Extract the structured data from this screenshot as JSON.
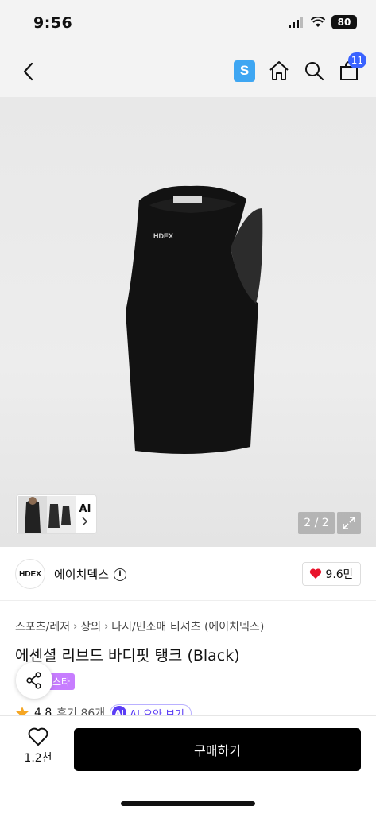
{
  "status_bar": {
    "time": "9:56",
    "battery": "80"
  },
  "nav": {
    "badge_letter": "S",
    "cart_count": "11"
  },
  "gallery": {
    "thumb_label": "AI",
    "counter": "2 / 2",
    "product_logo": "HDEX"
  },
  "brand": {
    "logo_text": "HDEX",
    "name": "에이치덱스",
    "likes": "9.6만"
  },
  "breadcrumb": [
    "스포츠/레저",
    "상의",
    "나시/민소매 티셔츠 (에이치덱스)"
  ],
  "product": {
    "title": "에센셜 리브드 바디핏 탱크 (Black)",
    "tag": "스타",
    "rating": "4.8",
    "reviews": "후기 86개",
    "ai_summary": "AI 요약 보기"
  },
  "bottom": {
    "wish_count": "1.2천",
    "buy_label": "구매하기"
  },
  "colors": {
    "accent_blue": "#3ea6f2",
    "cart_badge": "#3a63ff",
    "tag_purple": "#c77dff",
    "heart_red": "#e8132b",
    "star": "#f5a623"
  }
}
